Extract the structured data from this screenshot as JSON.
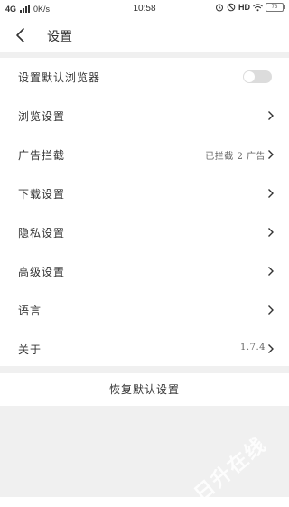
{
  "status_bar": {
    "network": "4G",
    "speed": "0K/s",
    "time": "10:58",
    "hd": "HD",
    "battery": "73"
  },
  "header": {
    "title": "设置"
  },
  "settings": {
    "items": [
      {
        "label": "设置默认浏览器",
        "type": "toggle",
        "on": false
      },
      {
        "label": "浏览设置",
        "type": "link"
      },
      {
        "label": "广告拦截",
        "type": "link",
        "value": "已拦截 2 广告"
      },
      {
        "label": "下载设置",
        "type": "link"
      },
      {
        "label": "隐私设置",
        "type": "link"
      },
      {
        "label": "高级设置",
        "type": "link"
      },
      {
        "label": "语言",
        "type": "link"
      },
      {
        "label": "关于",
        "type": "link",
        "value": "1.7.4"
      }
    ]
  },
  "restore_button": "恢复默认设置",
  "watermark": "日升在线",
  "colors": {
    "background": "#ffffff",
    "separator": "#f0f0f0",
    "text": "#333333",
    "toggle_off": "#dcdcdc"
  }
}
